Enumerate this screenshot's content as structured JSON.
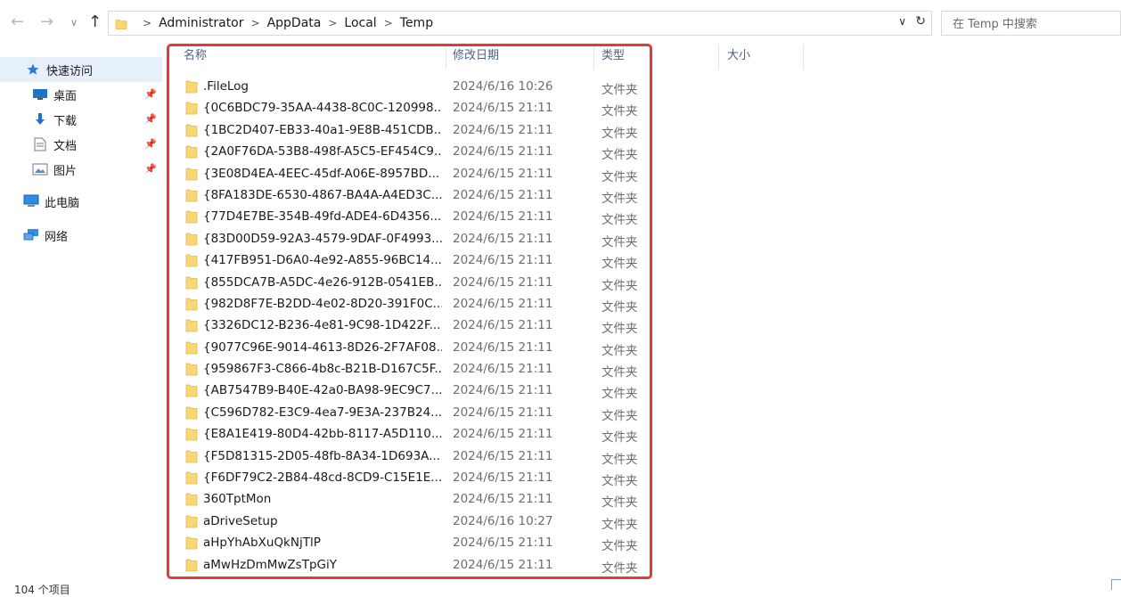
{
  "address": {
    "crumbs": [
      "Administrator",
      "AppData",
      "Local",
      "Temp"
    ]
  },
  "search": {
    "placeholder": "在 Temp 中搜索"
  },
  "sidebar": {
    "items": [
      {
        "label": "快速访问",
        "icon": "star-icon",
        "pinned": false,
        "active": true
      },
      {
        "label": "桌面",
        "icon": "desktop-icon",
        "pinned": true,
        "active": false
      },
      {
        "label": "下载",
        "icon": "download-icon",
        "pinned": true,
        "active": false
      },
      {
        "label": "文档",
        "icon": "document-icon",
        "pinned": true,
        "active": false
      },
      {
        "label": "图片",
        "icon": "pictures-icon",
        "pinned": true,
        "active": false
      },
      {
        "label": "此电脑",
        "icon": "computer-icon",
        "pinned": false,
        "active": false
      },
      {
        "label": "网络",
        "icon": "network-icon",
        "pinned": false,
        "active": false
      }
    ]
  },
  "columns": {
    "name": "名称",
    "modified": "修改日期",
    "type": "类型",
    "size": "大小"
  },
  "files": [
    {
      "name": ".FileLog",
      "modified": "2024/6/16 10:26",
      "type": "文件夹"
    },
    {
      "name": "{0C6BDC79-35AA-4438-8C0C-120998...",
      "modified": "2024/6/15 21:11",
      "type": "文件夹"
    },
    {
      "name": "{1BC2D407-EB33-40a1-9E8B-451CDB...",
      "modified": "2024/6/15 21:11",
      "type": "文件夹"
    },
    {
      "name": "{2A0F76DA-53B8-498f-A5C5-EF454C9...",
      "modified": "2024/6/15 21:11",
      "type": "文件夹"
    },
    {
      "name": "{3E08D4EA-4EEC-45df-A06E-8957BD...",
      "modified": "2024/6/15 21:11",
      "type": "文件夹"
    },
    {
      "name": "{8FA183DE-6530-4867-BA4A-A4ED3C...",
      "modified": "2024/6/15 21:11",
      "type": "文件夹"
    },
    {
      "name": "{77D4E7BE-354B-49fd-ADE4-6D4356...",
      "modified": "2024/6/15 21:11",
      "type": "文件夹"
    },
    {
      "name": "{83D00D59-92A3-4579-9DAF-0F4993...",
      "modified": "2024/6/15 21:11",
      "type": "文件夹"
    },
    {
      "name": "{417FB951-D6A0-4e92-A855-96BC14...",
      "modified": "2024/6/15 21:11",
      "type": "文件夹"
    },
    {
      "name": "{855DCA7B-A5DC-4e26-912B-0541EB...",
      "modified": "2024/6/15 21:11",
      "type": "文件夹"
    },
    {
      "name": "{982D8F7E-B2DD-4e02-8D20-391F0C...",
      "modified": "2024/6/15 21:11",
      "type": "文件夹"
    },
    {
      "name": "{3326DC12-B236-4e81-9C98-1D422F...",
      "modified": "2024/6/15 21:11",
      "type": "文件夹"
    },
    {
      "name": "{9077C96E-9014-4613-8D26-2F7AF08...",
      "modified": "2024/6/15 21:11",
      "type": "文件夹"
    },
    {
      "name": "{959867F3-C866-4b8c-B21B-D167C5F...",
      "modified": "2024/6/15 21:11",
      "type": "文件夹"
    },
    {
      "name": "{AB7547B9-B40E-42a0-BA98-9EC9C7...",
      "modified": "2024/6/15 21:11",
      "type": "文件夹"
    },
    {
      "name": "{C596D782-E3C9-4ea7-9E3A-237B24...",
      "modified": "2024/6/15 21:11",
      "type": "文件夹"
    },
    {
      "name": "{E8A1E419-80D4-42bb-8117-A5D110...",
      "modified": "2024/6/15 21:11",
      "type": "文件夹"
    },
    {
      "name": "{F5D81315-2D05-48fb-8A34-1D693A...",
      "modified": "2024/6/15 21:11",
      "type": "文件夹"
    },
    {
      "name": "{F6DF79C2-2B84-48cd-8CD9-C15E1E...",
      "modified": "2024/6/15 21:11",
      "type": "文件夹"
    },
    {
      "name": "360TptMon",
      "modified": "2024/6/15 21:11",
      "type": "文件夹"
    },
    {
      "name": "aDriveSetup",
      "modified": "2024/6/16 10:27",
      "type": "文件夹"
    },
    {
      "name": "aHpYhAbXuQkNjTlP",
      "modified": "2024/6/15 21:11",
      "type": "文件夹"
    },
    {
      "name": "aMwHzDmMwZsTpGiY",
      "modified": "2024/6/15 21:11",
      "type": "文件夹"
    }
  ],
  "status": {
    "item_count": "104 个项目"
  },
  "colors": {
    "folder": "#f8d775",
    "highlight": "#e53935",
    "header_text": "#4d6185",
    "selection": "#e5f0fb"
  }
}
